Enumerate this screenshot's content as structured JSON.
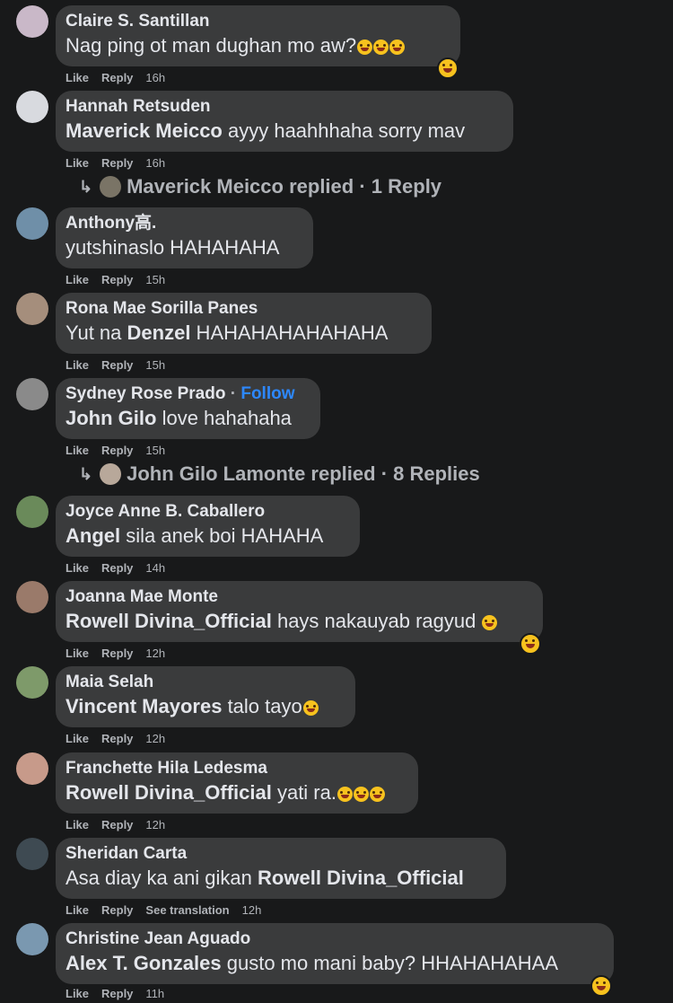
{
  "actions": {
    "like": "Like",
    "reply": "Reply",
    "see_translation": "See translation"
  },
  "follow_label": "Follow",
  "comments": [
    {
      "author": "Claire S. Santillan",
      "tag": "",
      "text": "Nag ping ot man dughan mo aw?",
      "time": "16h"
    },
    {
      "author": "Hannah Retsuden",
      "tag": "Maverick Meicco",
      "text": " ayyy haahhhaha sorry mav",
      "time": "16h",
      "replies": {
        "name": "Maverick Meicco replied",
        "count": "1 Reply"
      }
    },
    {
      "author": "Anthony高.",
      "tag": "",
      "text": "yutshinaslo HAHAHAHA",
      "time": "15h"
    },
    {
      "author": "Rona Mae Sorilla Panes",
      "text_pre": "Yut na ",
      "tag": "Denzel",
      "text": " HAHAHAHAHAHAHA",
      "time": "15h"
    },
    {
      "author": "Sydney Rose Prado",
      "tag": "John Gilo",
      "text": " love hahahaha",
      "time": "15h",
      "replies": {
        "name": "John Gilo Lamonte replied",
        "count": "8 Replies"
      }
    },
    {
      "author": "Joyce Anne B. Caballero",
      "tag": "Angel",
      "text": " sila anek boi HAHAHA",
      "time": "14h"
    },
    {
      "author": "Joanna Mae Monte",
      "tag": "Rowell Divina_Official",
      "text": " hays nakauyab ragyud ",
      "time": "12h"
    },
    {
      "author": "Maia Selah",
      "tag": "Vincent Mayores",
      "text": " talo tayo",
      "time": "12h"
    },
    {
      "author": "Franchette Hila Ledesma",
      "tag": "Rowell Divina_Official",
      "text": " yati ra.",
      "time": "12h"
    },
    {
      "author": "Sheridan Carta",
      "text_pre": "Asa diay ka ani gikan ",
      "tag": "Rowell Divina_Official",
      "text": "",
      "time": "12h"
    },
    {
      "author": "Christine Jean Aguado",
      "tag": "Alex T. Gonzales",
      "text": " gusto mo mani baby? HHAHAHAHAA",
      "time": "11h"
    }
  ]
}
